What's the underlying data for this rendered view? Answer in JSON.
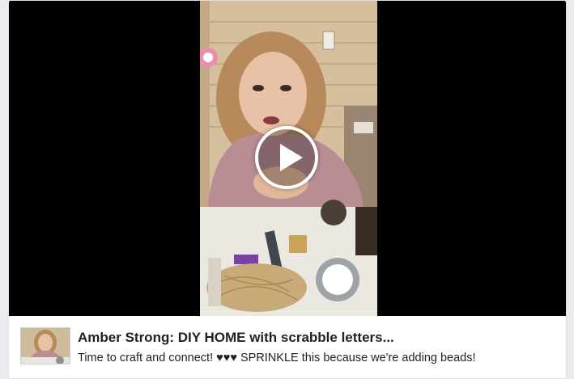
{
  "post": {
    "title": "Amber Strong: DIY HOME with scrabble letters...",
    "description": "Time to craft and connect! ♥♥♥ SPRINKLE this because we're adding beads!"
  },
  "video": {
    "play_icon": "play-icon",
    "background_color": "#000000",
    "overlay_color": "#ffffff"
  }
}
